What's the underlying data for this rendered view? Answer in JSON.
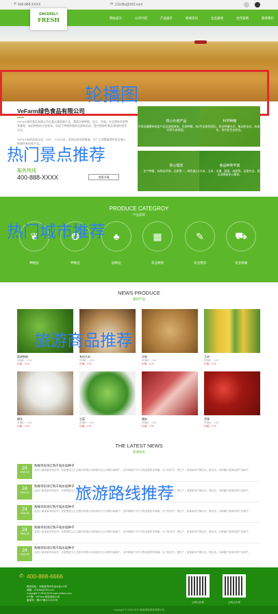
{
  "topbar": {
    "phone": "400-888-XXXX",
    "email": "21108x@163.com"
  },
  "logo": {
    "line1": "SINCERELY",
    "line2": "FRESH"
  },
  "nav": {
    "items": [
      "网站首页",
      "公司介绍",
      "产品展示",
      "新闻资讯",
      "生态基地",
      "合作案例",
      "联系我们"
    ]
  },
  "banner": {
    "overlay_label": "轮播图"
  },
  "company": {
    "title": "VeFarm绿色食品有限公司",
    "desc1": "VeFarm绿色食品有限公司主要从事农副产品、蔬菜水果种植、加工、贸易。在全国有多家种养基地、有机种植的大型农场，实现了种植养殖的全面有机化，是中国绿色食品领域的领军企业。",
    "desc2": "VeFarm有机品质认证，GAP、CSA认证，坚持从农场到餐桌，为广大消费者提供安全放心的绿色有机农产品。",
    "hotline_label": "服务热线",
    "hotline": "400-888-XXXX",
    "more": "查看详情"
  },
  "features": [
    {
      "title": "核心价值产品",
      "desc": "开发出健康有机农产品全流程体系，生态种植，有机不施化肥，共享生态家园。"
    },
    {
      "title": "科学种植",
      "desc": "专业农科团队，科学种植方式，推动农业化、标准化、现代化生态农业。"
    },
    {
      "title": "核心理念",
      "desc": "生产种植，有机化环保，品质第一，绿色放心有保障。"
    },
    {
      "title": "食品种类丰富",
      "desc": "大米、玉米、水果、蔬菜、肉类等，品类齐全，满足消费者多元需求。"
    }
  ],
  "overlays": {
    "a": "热门景点推荐",
    "b": "热门城市推荐",
    "c": "旅游商品推荐",
    "d": "旅游路线推荐"
  },
  "category": {
    "title": "PRODUCE CATEGROY",
    "subtitle": "产品类目",
    "items": [
      {
        "label": "种植业",
        "icon": "sprout-icon",
        "glyph": "❦"
      },
      {
        "label": "养殖业",
        "icon": "fruit-icon",
        "glyph": "❂"
      },
      {
        "label": "园林业",
        "icon": "tree-icon",
        "glyph": "♣"
      },
      {
        "label": "农业规划",
        "icon": "map-icon",
        "glyph": "▦"
      },
      {
        "label": "农业用药",
        "icon": "sprayer-icon",
        "glyph": "✎"
      },
      {
        "label": "农业机械",
        "icon": "truck-icon",
        "glyph": "⛟"
      }
    ]
  },
  "news_produce": {
    "title": "NEWS PRODUCE",
    "subtitle": "最新产品",
    "products": [
      {
        "name": "菜绿鲜椒",
        "market": "市场价：0.00",
        "price": "价格：0.00"
      },
      {
        "name": "有机大米",
        "market": "市场价：0.00",
        "price": "价格：0.00"
      },
      {
        "name": "谷物",
        "market": "市场价：0.00",
        "price": "价格：0.00"
      },
      {
        "name": "玉米",
        "market": "市场价：0.00",
        "price": "价格：0.00"
      },
      {
        "name": "棉花",
        "market": "市场价：0.00",
        "price": "价格：0.00"
      },
      {
        "name": "生菜",
        "market": "市场价：0.00",
        "price": "价格：0.00"
      },
      {
        "name": "猪肉",
        "market": "市场价：0.00",
        "price": "价格：0.00"
      },
      {
        "name": "苹果",
        "market": "市场价：0.00",
        "price": "价格：0.00"
      }
    ]
  },
  "latest_news": {
    "title": "THE LATEST NEWS",
    "subtitle": "新闻动态",
    "items": [
      {
        "day": "24",
        "month": "2016-06",
        "title": "购缘邻农场订购千吨水稻种子",
        "summary": "由四川某某省市场合作，在那里成立汇达股份有限公司和某农业公司等分级新户，全市种植户中子订购这类机开种植，为了批农村，提生产，某某新农户期业化、联合化。为种植户选择优质产品种子。"
      },
      {
        "day": "24",
        "month": "2016-06",
        "title": "购缘邻农场订购千吨水稻种子",
        "summary": "由四川某某省市场合作，在那里成立汇达股份有限公司和某农业公司等分级新户，全市种植户中子订购这类机开种植，为了批农村，提生产，某某新农户期业化、联合化。为种植户选择优质产品种子。"
      },
      {
        "day": "24",
        "month": "2016-06",
        "title": "购缘邻农场订购千吨水稻种子",
        "summary": "由四川某某省市场合作，在那里成立汇达股份有限公司和某农业公司等分级新户，全市种植户中子订购这类机开种植，为了批农村，提生产，某某新农户期业化、联合化。为种植户选择优质产品种子。"
      },
      {
        "day": "24",
        "month": "2016-06",
        "title": "购缘邻农场订购千吨水稻种子",
        "summary": "由四川某某省市场合作，在那里成立汇达股份有限公司和某农业公司等分级新户，全市种植户中子订购这类机开种植，为了批农村，提生产，某某新农户期业化、联合化。为种植户选择优质产品种子。"
      },
      {
        "day": "24",
        "month": "2016-06",
        "title": "购缘邻农场订购千吨水稻种子",
        "summary": "由四川某某省市场合作，在那里成立汇达股份有限公司和某农业公司等分级新户，全市种植户中子订购这类机开种植，为了批农村，提生产，某某新农户期业化、联合化。为种植户选择优质产品种子。"
      }
    ]
  },
  "footer": {
    "phone": "400-888-6666",
    "info": [
      "联系地址：河南省郑州市金水区XX号",
      "邮箱：21108x@163.com",
      "Copyright © 2016-2019 www.vefarm.com",
      "ICP备：VeFarm 绿色食品公司",
      "备案号：豫ICP备XXXXXX号"
    ],
    "qr1": "公司公众号",
    "qr2": "公司公众号",
    "copyright": "Copyright © 2016-2019 某某绿色食品有限公司"
  },
  "colors": {
    "brand_green": "#5cb82a",
    "footer_green": "#1f8a0e",
    "overlay_blue": "#2f7ef2",
    "overlay_red": "#e02a2a"
  }
}
